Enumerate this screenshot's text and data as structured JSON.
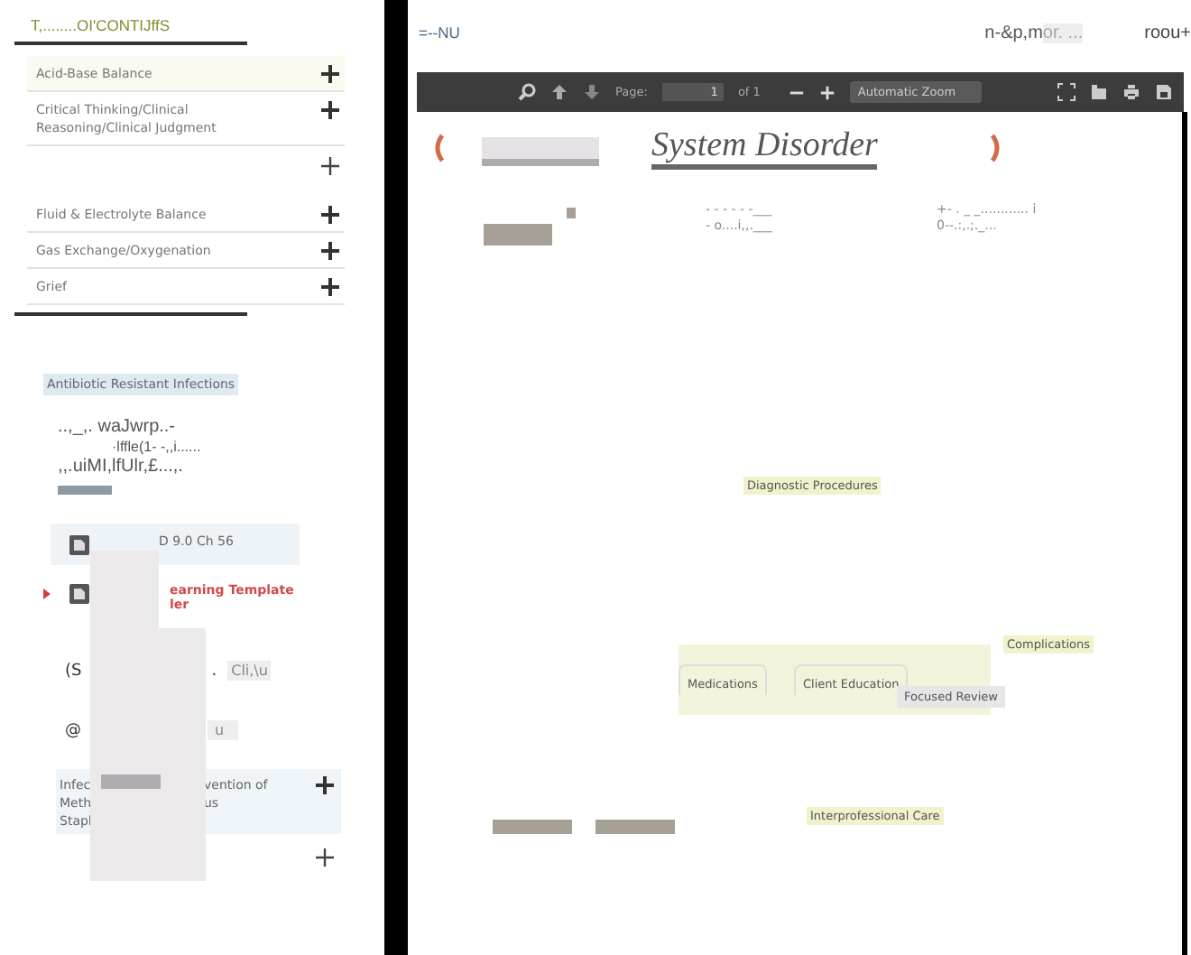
{
  "sidebar": {
    "title": "T,........OI'CONTIJffS",
    "topics": [
      {
        "label": "Acid-Base Balance",
        "highlighted": true
      },
      {
        "label": "Critical Thinking/Clinical Reasoning/Clinical Judgment",
        "highlighted": false
      },
      {
        "label": "Fluid & Electrolyte Balance",
        "highlighted": false
      },
      {
        "label": "Gas Exchange/Oxygenation",
        "highlighted": false
      },
      {
        "label": "Grief",
        "highlighted": false
      }
    ],
    "tag": "Antibiotic Resistant Infections",
    "garbled_lines": [
      "..,_,. waJwrp..-",
      "·lffle(1-  -,,i......",
      ",,.uiMI,lfUlr,£...,."
    ],
    "files": [
      {
        "lines": [
          "D 9.0 Ch 56"
        ],
        "current": false
      },
      {
        "lines": [
          "earning Template",
          "ler"
        ],
        "current": true
      }
    ],
    "notes": [
      {
        "mark": "(S",
        "dot": ".",
        "chip": "Cli,\\u"
      },
      {
        "mark": "@",
        "chip": "u"
      }
    ],
    "bottom_topic": {
      "left_lines": [
        "Infec",
        "Meth",
        "Stapl"
      ],
      "right_lines": [
        "vention of",
        "us"
      ]
    }
  },
  "header": {
    "left": "=--NU",
    "middle": "n-&p,m",
    "middle_muted": "or. ...",
    "right": "roou+"
  },
  "viewer": {
    "toolbar": {
      "page_label": "Page:",
      "page": "1",
      "of": "of 1",
      "zoom": "Automatic Zoom"
    },
    "page": {
      "title": "System Disorder",
      "notes": [
        {
          "top": "- - - - - -___",
          "bottom": "- o....i,,.___"
        },
        {
          "top": "+- . _ _............ i",
          "bottom": "0--.:,.;._..."
        }
      ],
      "map": [
        {
          "kind": "heading",
          "label": "Diagnostic Procedures"
        },
        {
          "kind": "tab",
          "label": "Medications"
        },
        {
          "kind": "tab",
          "label": "Client Education"
        },
        {
          "kind": "heading",
          "label": "Complications"
        },
        {
          "kind": "tooltip",
          "label": "Focused Review"
        },
        {
          "kind": "heading",
          "label": "Interprofessional Care"
        }
      ]
    }
  }
}
